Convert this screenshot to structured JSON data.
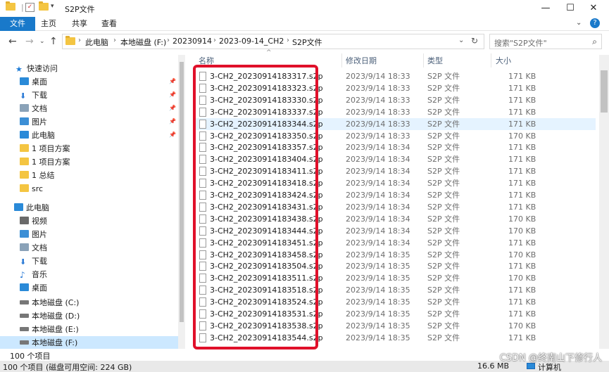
{
  "window": {
    "title": "S2P文件",
    "minimize_glyph": "—",
    "maximize_glyph": "☐",
    "close_glyph": "✕"
  },
  "ribbon": {
    "tabs": [
      "文件",
      "主页",
      "共享",
      "查看"
    ]
  },
  "address": {
    "crumbs": [
      "此电脑",
      "本地磁盘 (F:)",
      "20230914",
      "2023-09-14_CH2",
      "S2P文件"
    ],
    "search_placeholder": "搜索\"S2P文件\""
  },
  "sidebar": {
    "items": [
      {
        "label": "快速访问",
        "icon": "star-icon",
        "color": "#1e7bd6",
        "pinned": false
      },
      {
        "label": "桌面",
        "icon": "desktop-icon",
        "color": "#2a8ad8",
        "pinned": true
      },
      {
        "label": "下载",
        "icon": "download-icon",
        "color": "#2a7ad6",
        "pinned": true
      },
      {
        "label": "文档",
        "icon": "document-icon",
        "color": "#8aa2b8",
        "pinned": true
      },
      {
        "label": "图片",
        "icon": "pictures-icon",
        "color": "#3c8fd6",
        "pinned": true
      },
      {
        "label": "此电脑",
        "icon": "computer-icon",
        "color": "#2a8ad8",
        "pinned": true
      },
      {
        "label": "1 项目方案",
        "icon": "folder-icon",
        "color": "#f4c542",
        "pinned": false
      },
      {
        "label": "1 项目方案",
        "icon": "folder-icon",
        "color": "#f4c542",
        "pinned": false
      },
      {
        "label": "1 总结",
        "icon": "folder-icon",
        "color": "#f4c542",
        "pinned": false
      },
      {
        "label": "src",
        "icon": "folder-icon",
        "color": "#f4c542",
        "pinned": false
      },
      {
        "label": "此电脑",
        "icon": "computer-icon",
        "color": "#2a8ad8",
        "pinned": false
      },
      {
        "label": "视频",
        "icon": "video-icon",
        "color": "#6a6a6a",
        "pinned": false
      },
      {
        "label": "图片",
        "icon": "pictures-icon",
        "color": "#3c8fd6",
        "pinned": false
      },
      {
        "label": "文档",
        "icon": "document-icon",
        "color": "#8aa2b8",
        "pinned": false
      },
      {
        "label": "下载",
        "icon": "download-icon",
        "color": "#2a7ad6",
        "pinned": false
      },
      {
        "label": "音乐",
        "icon": "music-icon",
        "color": "#2a7ad6",
        "pinned": false
      },
      {
        "label": "桌面",
        "icon": "desktop-icon",
        "color": "#2a8ad8",
        "pinned": false
      },
      {
        "label": "本地磁盘 (C:)",
        "icon": "drive-icon",
        "color": "#777777",
        "pinned": false
      },
      {
        "label": "本地磁盘 (D:)",
        "icon": "drive-icon",
        "color": "#777777",
        "pinned": false
      },
      {
        "label": "本地磁盘 (E:)",
        "icon": "drive-icon",
        "color": "#777777",
        "pinned": false
      },
      {
        "label": "本地磁盘 (F:)",
        "icon": "drive-icon",
        "color": "#777777",
        "pinned": false
      }
    ]
  },
  "columns": {
    "name": "名称",
    "date": "修改日期",
    "type": "类型",
    "size": "大小"
  },
  "files": [
    {
      "name": "3-CH2_20230914183317.s2p",
      "date": "2023/9/14 18:33",
      "type": "S2P 文件",
      "size": "171 KB"
    },
    {
      "name": "3-CH2_20230914183323.s2p",
      "date": "2023/9/14 18:33",
      "type": "S2P 文件",
      "size": "171 KB"
    },
    {
      "name": "3-CH2_20230914183330.s2p",
      "date": "2023/9/14 18:33",
      "type": "S2P 文件",
      "size": "171 KB"
    },
    {
      "name": "3-CH2_20230914183337.s2p",
      "date": "2023/9/14 18:33",
      "type": "S2P 文件",
      "size": "171 KB"
    },
    {
      "name": "3-CH2_20230914183344.s2p",
      "date": "2023/9/14 18:33",
      "type": "S2P 文件",
      "size": "171 KB"
    },
    {
      "name": "3-CH2_20230914183350.s2p",
      "date": "2023/9/14 18:33",
      "type": "S2P 文件",
      "size": "170 KB"
    },
    {
      "name": "3-CH2_20230914183357.s2p",
      "date": "2023/9/14 18:34",
      "type": "S2P 文件",
      "size": "171 KB"
    },
    {
      "name": "3-CH2_20230914183404.s2p",
      "date": "2023/9/14 18:34",
      "type": "S2P 文件",
      "size": "171 KB"
    },
    {
      "name": "3-CH2_20230914183411.s2p",
      "date": "2023/9/14 18:34",
      "type": "S2P 文件",
      "size": "171 KB"
    },
    {
      "name": "3-CH2_20230914183418.s2p",
      "date": "2023/9/14 18:34",
      "type": "S2P 文件",
      "size": "171 KB"
    },
    {
      "name": "3-CH2_20230914183424.s2p",
      "date": "2023/9/14 18:34",
      "type": "S2P 文件",
      "size": "171 KB"
    },
    {
      "name": "3-CH2_20230914183431.s2p",
      "date": "2023/9/14 18:34",
      "type": "S2P 文件",
      "size": "171 KB"
    },
    {
      "name": "3-CH2_20230914183438.s2p",
      "date": "2023/9/14 18:34",
      "type": "S2P 文件",
      "size": "170 KB"
    },
    {
      "name": "3-CH2_20230914183444.s2p",
      "date": "2023/9/14 18:34",
      "type": "S2P 文件",
      "size": "170 KB"
    },
    {
      "name": "3-CH2_20230914183451.s2p",
      "date": "2023/9/14 18:34",
      "type": "S2P 文件",
      "size": "171 KB"
    },
    {
      "name": "3-CH2_20230914183458.s2p",
      "date": "2023/9/14 18:35",
      "type": "S2P 文件",
      "size": "170 KB"
    },
    {
      "name": "3-CH2_20230914183504.s2p",
      "date": "2023/9/14 18:35",
      "type": "S2P 文件",
      "size": "171 KB"
    },
    {
      "name": "3-CH2_20230914183511.s2p",
      "date": "2023/9/14 18:35",
      "type": "S2P 文件",
      "size": "170 KB"
    },
    {
      "name": "3-CH2_20230914183518.s2p",
      "date": "2023/9/14 18:35",
      "type": "S2P 文件",
      "size": "171 KB"
    },
    {
      "name": "3-CH2_20230914183524.s2p",
      "date": "2023/9/14 18:35",
      "type": "S2P 文件",
      "size": "171 KB"
    },
    {
      "name": "3-CH2_20230914183531.s2p",
      "date": "2023/9/14 18:35",
      "type": "S2P 文件",
      "size": "171 KB"
    },
    {
      "name": "3-CH2_20230914183538.s2p",
      "date": "2023/9/14 18:35",
      "type": "S2P 文件",
      "size": "170 KB"
    },
    {
      "name": "3-CH2_20230914183544.s2p",
      "date": "2023/9/14 18:35",
      "type": "S2P 文件",
      "size": "171 KB"
    }
  ],
  "selected_row": 4,
  "highlight_color": "#e0102a",
  "status": {
    "item_count": "100 个项目",
    "footer": "100 个项目 (磁盘可用空间: 224 GB)",
    "size_total": "16.6 MB",
    "computer_label": "计算机"
  },
  "watermark": "CSDN @终南山下修行人"
}
